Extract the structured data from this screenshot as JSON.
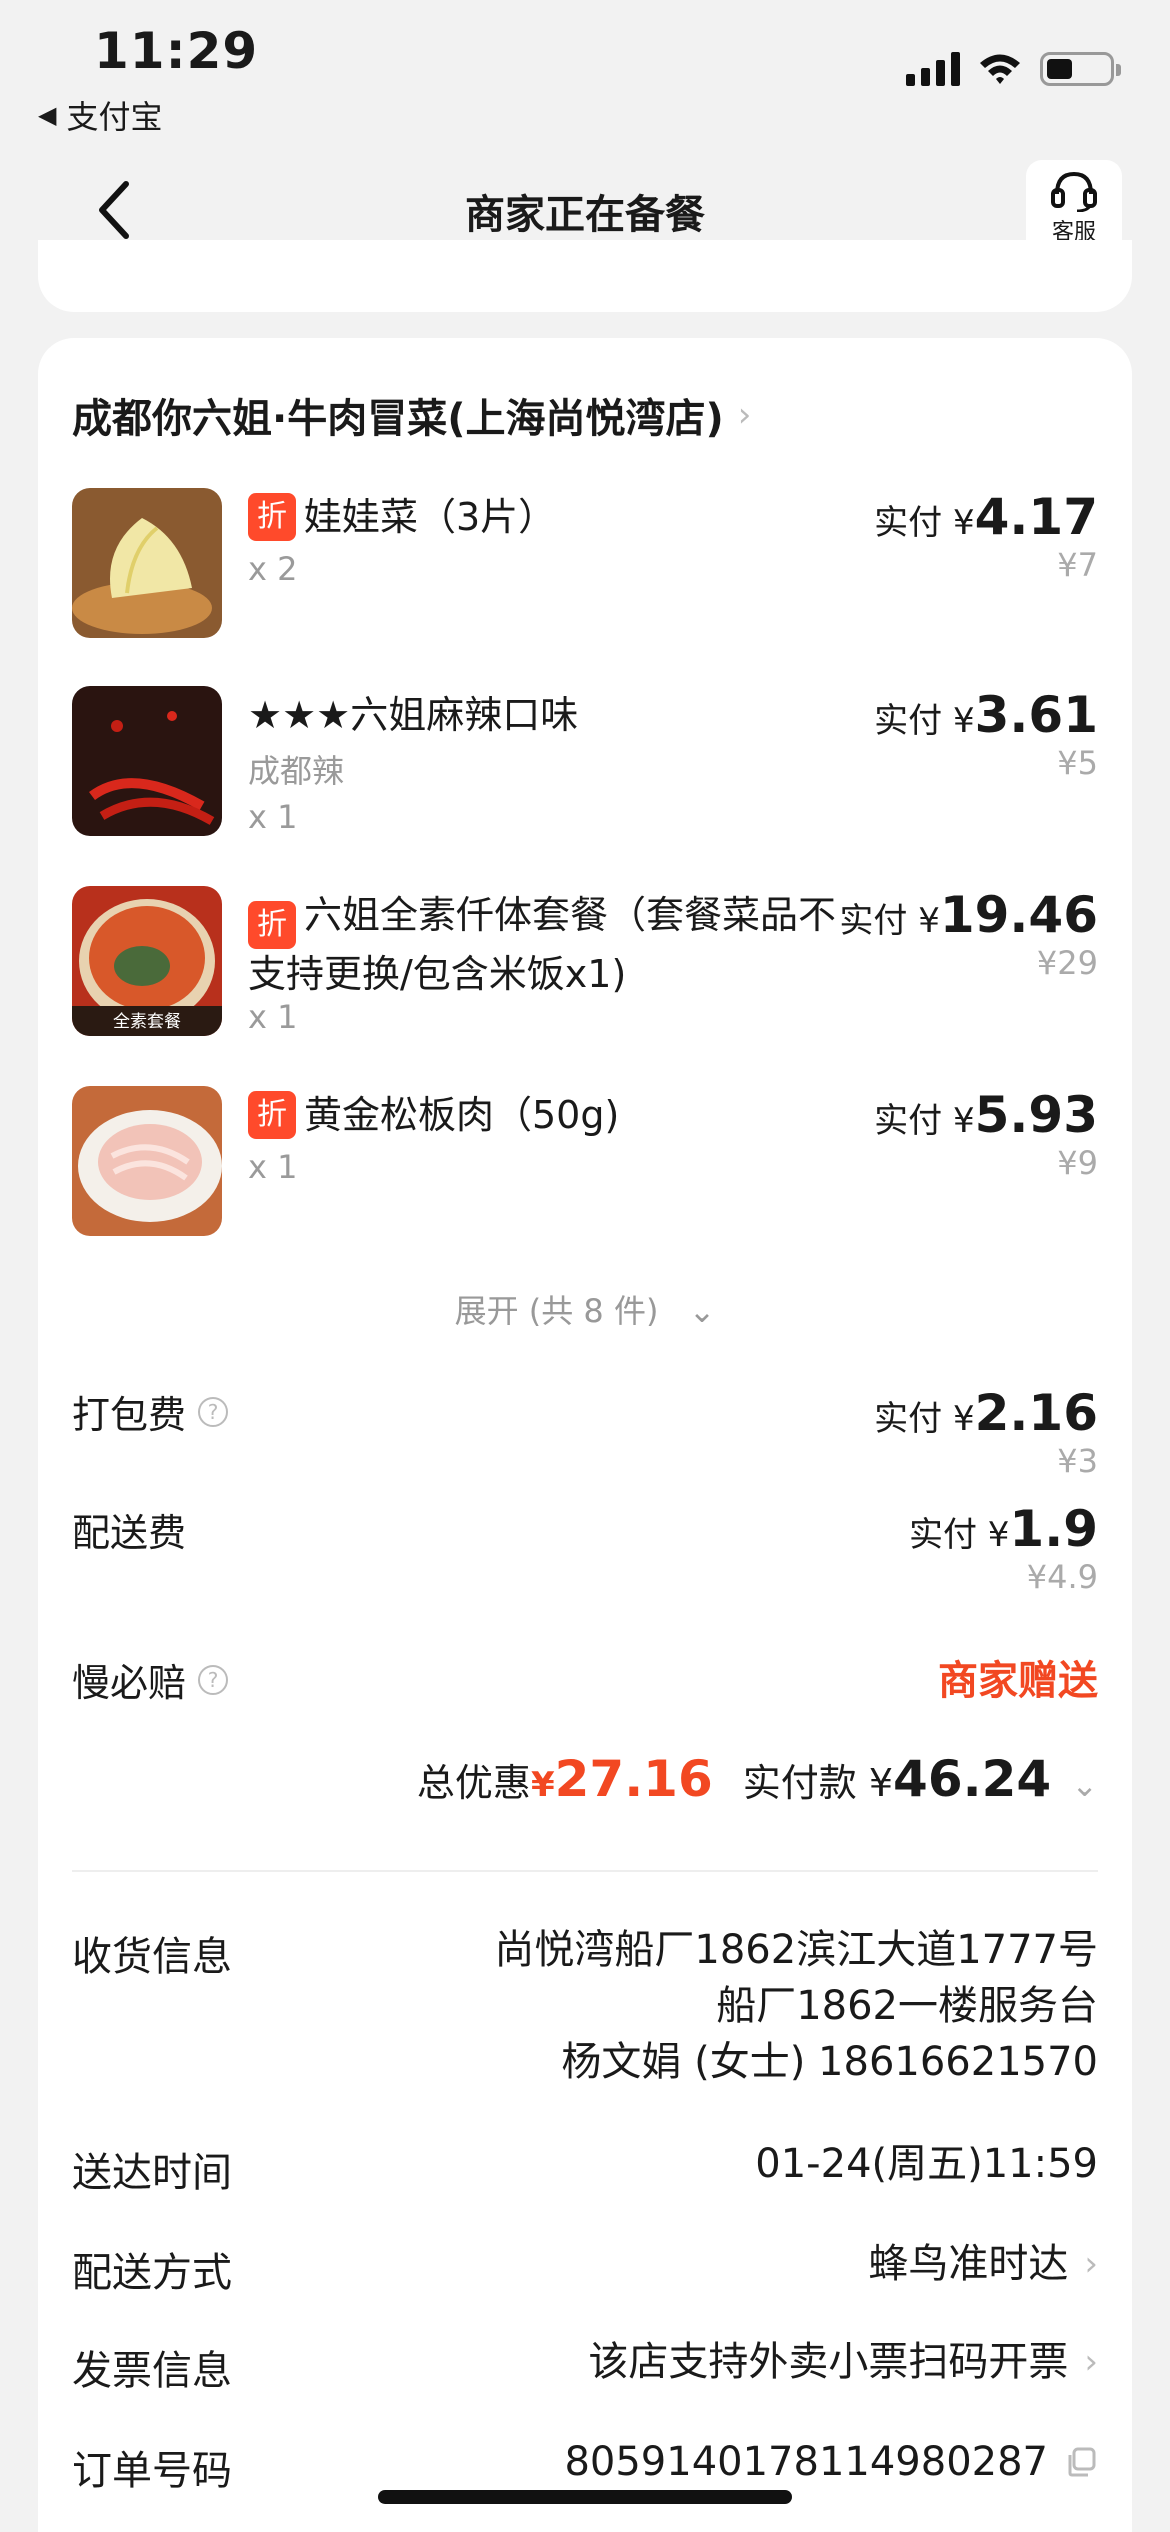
{
  "status_bar": {
    "time": "11:29",
    "back_app": "支付宝"
  },
  "nav": {
    "title": "商家正在备餐",
    "service_label": "客服"
  },
  "store": {
    "name": "成都你六姐·牛肉冒菜(上海尚悦湾店)"
  },
  "items": [
    {
      "name": "娃娃菜（3片）",
      "discount_badge": "折",
      "spec": "",
      "qty": "x 2",
      "paid_label": "实付 ¥",
      "paid": "4.17",
      "original": "¥7"
    },
    {
      "name": "★★★六姐麻辣口味",
      "discount_badge": "",
      "spec": "成都辣",
      "qty": "x 1",
      "paid_label": "实付 ¥",
      "paid": "3.61",
      "original": "¥5"
    },
    {
      "name": "六姐全素仟体套餐（套餐菜品不支持更换/包含米饭x1)",
      "discount_badge": "折",
      "spec": "",
      "qty": "x 1",
      "paid_label": "实付 ¥",
      "paid": "19.46",
      "original": "¥29",
      "thumb_caption": "全素套餐"
    },
    {
      "name": "黄金松板肉（50g)",
      "discount_badge": "折",
      "spec": "",
      "qty": "x 1",
      "paid_label": "实付 ¥",
      "paid": "5.93",
      "original": "¥9"
    }
  ],
  "expand": {
    "label": "展开 (共 8 件)"
  },
  "fees": {
    "packing": {
      "label": "打包费",
      "paid_label": "实付 ¥",
      "paid": "2.16",
      "original": "¥3"
    },
    "delivery": {
      "label": "配送费",
      "paid_label": "实付 ¥",
      "paid": "1.9",
      "original": "¥4.9"
    },
    "late_comp": {
      "label": "慢必赔",
      "value": "商家赠送"
    }
  },
  "totals": {
    "discount_label": "总优惠",
    "discount_currency": "¥",
    "discount": "27.16",
    "paid_label": "实付款 ¥",
    "paid": "46.24"
  },
  "info": {
    "address": {
      "label": "收货信息",
      "line1": "尚悦湾船厂1862滨江大道1777号",
      "line2": "船厂1862一楼服务台",
      "line3": "杨文娟 (女士) 18616621570"
    },
    "arrival": {
      "label": "送达时间",
      "value": "01-24(周五)11:59"
    },
    "shipping": {
      "label": "配送方式",
      "value": "蜂鸟准时达"
    },
    "invoice": {
      "label": "发票信息",
      "value": "该店支持外卖小票扫码开票"
    },
    "order": {
      "label": "订单号码",
      "value": "8059140178114980287"
    }
  },
  "colors": {
    "accent_red": "#f24822",
    "badge_red": "#ff4a2b",
    "background": "#f2f2f2"
  }
}
